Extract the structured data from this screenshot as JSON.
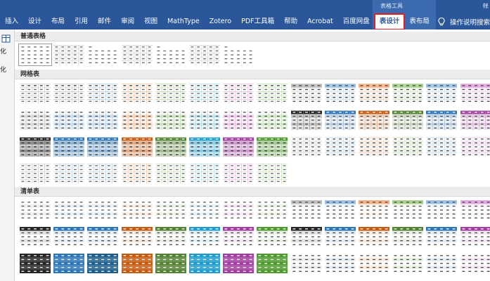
{
  "ribbon": {
    "context_label": "表格工具",
    "context_extra": "帐",
    "tabs": [
      {
        "label": "插入",
        "name": "tab-insert"
      },
      {
        "label": "设计",
        "name": "tab-design"
      },
      {
        "label": "布局",
        "name": "tab-layout"
      },
      {
        "label": "引用",
        "name": "tab-references"
      },
      {
        "label": "邮件",
        "name": "tab-mailings"
      },
      {
        "label": "审阅",
        "name": "tab-review"
      },
      {
        "label": "视图",
        "name": "tab-view"
      },
      {
        "label": "MathType",
        "name": "tab-mathtype"
      },
      {
        "label": "Zotero",
        "name": "tab-zotero"
      },
      {
        "label": "PDF工具箱",
        "name": "tab-pdf-toolbox"
      },
      {
        "label": "帮助",
        "name": "tab-help"
      },
      {
        "label": "Acrobat",
        "name": "tab-acrobat"
      },
      {
        "label": "百度网盘",
        "name": "tab-baidu-netdisk"
      },
      {
        "label": "表设计",
        "name": "tab-table-design",
        "active": true
      },
      {
        "label": "表布局",
        "name": "tab-table-layout"
      }
    ],
    "tellme": "操作说明搜索",
    "colors": {
      "ribbon": "#2b579a",
      "highlight": "#e02020"
    }
  },
  "left_strip": {
    "label_top": "化",
    "label_bottom": "化"
  },
  "gallery": {
    "sections": [
      {
        "title": "普通表格",
        "rows": [
          [
            {
              "style": "plain",
              "selected": true
            },
            {
              "style": "plain-lines"
            },
            {
              "style": "plain-sparse"
            },
            {
              "style": "plain-lines"
            },
            {
              "style": "plain-sparse"
            },
            {
              "style": "plain-lines"
            },
            {
              "style": "plain-sparse"
            }
          ]
        ]
      },
      {
        "title": "网格表",
        "rows": [
          [
            {
              "style": "grid-light",
              "color": "#8c8c8c"
            },
            {
              "style": "grid-light",
              "color": "#8c8c8c"
            },
            {
              "style": "grid-light",
              "color": "#5b9bd5"
            },
            {
              "style": "grid-light",
              "color": "#ed7d31"
            },
            {
              "style": "grid-light",
              "color": "#70ad47"
            },
            {
              "style": "grid-light",
              "color": "#4bacc6"
            },
            {
              "style": "grid-light",
              "color": "#e070c0"
            },
            {
              "style": "grid-light",
              "color": "#70c050"
            },
            {
              "style": "grid-head",
              "color": "#bfbfbf"
            },
            {
              "style": "grid-head",
              "color": "#9dc3e6"
            },
            {
              "style": "grid-head",
              "color": "#f4b183"
            },
            {
              "style": "grid-head",
              "color": "#a9d18e"
            },
            {
              "style": "grid-head",
              "color": "#9dc3e6"
            },
            {
              "style": "grid-head",
              "color": "#e3a6e0"
            },
            {
              "style": "grid-head",
              "color": "#b4e0a0"
            }
          ],
          [
            {
              "style": "grid-medium",
              "color": "#8c8c8c"
            },
            {
              "style": "grid-medium",
              "color": "#5b9bd5"
            },
            {
              "style": "grid-medium",
              "color": "#5b9bd5"
            },
            {
              "style": "grid-medium",
              "color": "#ed7d31"
            },
            {
              "style": "grid-medium",
              "color": "#70ad47"
            },
            {
              "style": "grid-medium",
              "color": "#4bacc6"
            },
            {
              "style": "grid-medium",
              "color": "#d864c8"
            },
            {
              "style": "grid-medium",
              "color": "#70c050"
            },
            {
              "style": "grid-dark-head",
              "color": "#262626"
            },
            {
              "style": "grid-dark-head",
              "color": "#2e75b6"
            },
            {
              "style": "grid-dark-head",
              "color": "#c55a11"
            },
            {
              "style": "grid-dark-head",
              "color": "#548235"
            },
            {
              "style": "grid-dark-head",
              "color": "#2e75b6"
            },
            {
              "style": "grid-dark-head",
              "color": "#a23ea0"
            },
            {
              "style": "grid-dark-head",
              "color": "#4e9a2f"
            }
          ],
          [
            {
              "style": "grid-dark",
              "color": "#262626"
            },
            {
              "style": "grid-dark",
              "color": "#2e75b6"
            },
            {
              "style": "grid-dark",
              "color": "#2e75b6"
            },
            {
              "style": "grid-dark",
              "color": "#c55a11"
            },
            {
              "style": "grid-dark",
              "color": "#548235"
            },
            {
              "style": "grid-dark",
              "color": "#1f9ccc"
            },
            {
              "style": "grid-dark",
              "color": "#a23ea0"
            },
            {
              "style": "grid-dark",
              "color": "#4e9a2f"
            },
            {
              "style": "grid-stripe",
              "color": "#bfbfbf"
            },
            {
              "style": "grid-stripe",
              "color": "#9dc3e6"
            },
            {
              "style": "grid-stripe",
              "color": "#f4b183"
            },
            {
              "style": "grid-stripe",
              "color": "#a9d18e"
            },
            {
              "style": "grid-stripe",
              "color": "#9dc3e6"
            },
            {
              "style": "grid-stripe",
              "color": "#e3a6e0"
            },
            {
              "style": "grid-stripe",
              "color": "#b4e0a0"
            }
          ],
          [
            {
              "style": "grid-sparse",
              "color": "#8c8c8c"
            },
            {
              "style": "grid-sparse",
              "color": "#5b9bd5"
            },
            {
              "style": "grid-sparse",
              "color": "#5b9bd5"
            },
            {
              "style": "grid-sparse",
              "color": "#ed7d31"
            },
            {
              "style": "grid-sparse",
              "color": "#70ad47"
            },
            {
              "style": "grid-sparse",
              "color": "#4bacc6"
            },
            {
              "style": "grid-sparse",
              "color": "#d864c8"
            },
            {
              "style": "grid-sparse",
              "color": "#70c050"
            }
          ]
        ]
      },
      {
        "title": "清单表",
        "rows": [
          [
            {
              "style": "list-light",
              "color": "#8c8c8c"
            },
            {
              "style": "list-light",
              "color": "#5b9bd5"
            },
            {
              "style": "list-light",
              "color": "#5b9bd5"
            },
            {
              "style": "list-light",
              "color": "#ed7d31"
            },
            {
              "style": "list-light",
              "color": "#70ad47"
            },
            {
              "style": "list-light",
              "color": "#4bacc6"
            },
            {
              "style": "list-light",
              "color": "#d864c8"
            },
            {
              "style": "list-light",
              "color": "#70c050"
            },
            {
              "style": "list-head",
              "color": "#bfbfbf"
            },
            {
              "style": "list-head",
              "color": "#9dc3e6"
            },
            {
              "style": "list-head",
              "color": "#f4b183"
            },
            {
              "style": "list-head",
              "color": "#a9d18e"
            },
            {
              "style": "list-head",
              "color": "#9dc3e6"
            },
            {
              "style": "list-head",
              "color": "#e3a6e0"
            },
            {
              "style": "list-head",
              "color": "#b4e0a0"
            }
          ],
          [
            {
              "style": "list-dark-head",
              "color": "#262626"
            },
            {
              "style": "list-dark-head",
              "color": "#2e75b6"
            },
            {
              "style": "list-dark-head",
              "color": "#2e75b6"
            },
            {
              "style": "list-dark-head",
              "color": "#c55a11"
            },
            {
              "style": "list-dark-head",
              "color": "#548235"
            },
            {
              "style": "list-dark-head",
              "color": "#1f9ccc"
            },
            {
              "style": "list-dark-head",
              "color": "#a23ea0"
            },
            {
              "style": "list-dark-head",
              "color": "#4e9a2f"
            },
            {
              "style": "list-dark-head",
              "color": "#262626"
            },
            {
              "style": "list-dark-head",
              "color": "#2e75b6"
            },
            {
              "style": "list-dark-head",
              "color": "#c55a11"
            },
            {
              "style": "list-dark-head",
              "color": "#548235"
            },
            {
              "style": "list-dark-head",
              "color": "#2e75b6"
            },
            {
              "style": "list-dark-head",
              "color": "#a23ea0"
            },
            {
              "style": "list-dark-head",
              "color": "#4e9a2f"
            }
          ],
          [
            {
              "style": "list-dark",
              "color": "#262626"
            },
            {
              "style": "list-dark",
              "color": "#2e75b6"
            },
            {
              "style": "list-dark",
              "color": "#1f5f8b"
            },
            {
              "style": "list-dark",
              "color": "#c55a11"
            },
            {
              "style": "list-dark",
              "color": "#548235"
            },
            {
              "style": "list-dark",
              "color": "#1f9ccc"
            },
            {
              "style": "list-dark",
              "color": "#a23ea0"
            },
            {
              "style": "list-dark",
              "color": "#4e9a2f"
            },
            {
              "style": "list-stripe",
              "color": "#bfbfbf"
            },
            {
              "style": "list-stripe",
              "color": "#9dc3e6"
            },
            {
              "style": "list-stripe",
              "color": "#f4b183"
            },
            {
              "style": "list-stripe",
              "color": "#a9d18e"
            },
            {
              "style": "list-stripe",
              "color": "#9dc3e6"
            },
            {
              "style": "list-stripe",
              "color": "#e3a6e0"
            },
            {
              "style": "list-stripe",
              "color": "#b4e0a0"
            }
          ]
        ]
      }
    ]
  }
}
